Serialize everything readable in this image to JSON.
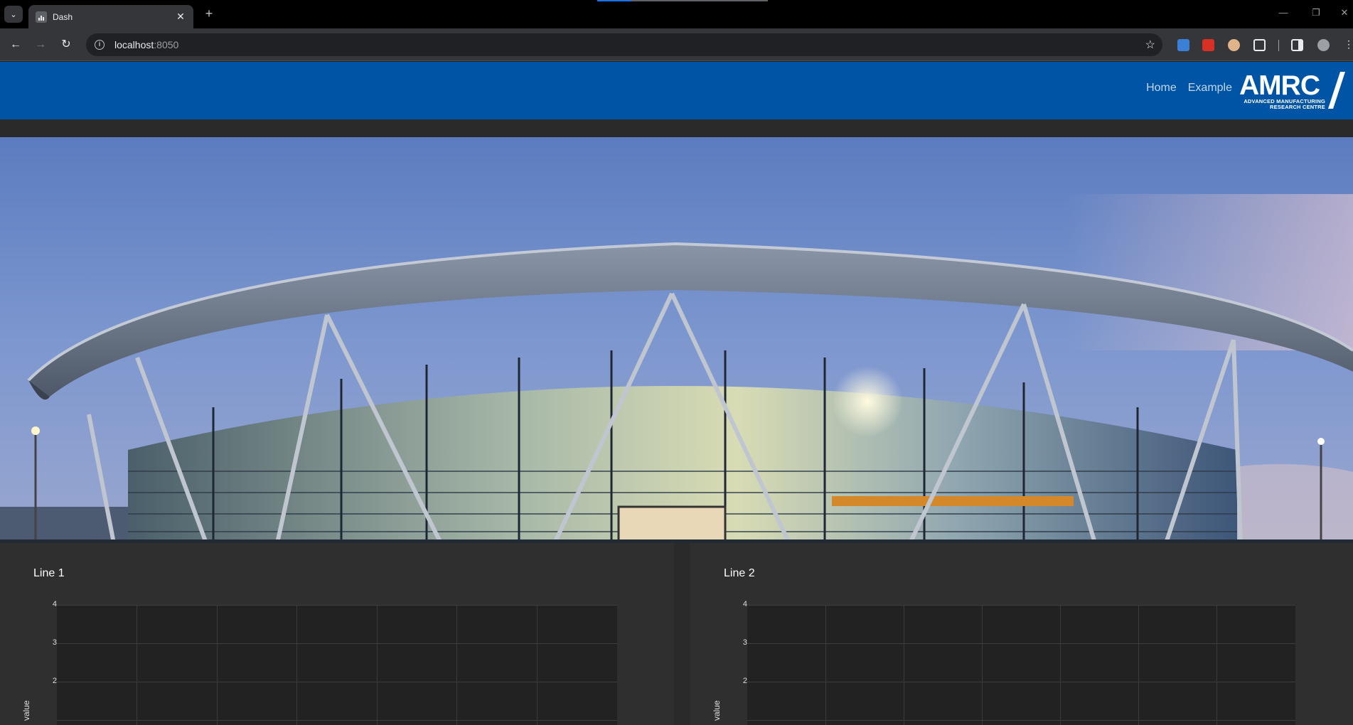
{
  "browser": {
    "tab_title": "Dash",
    "url_host": "localhost",
    "url_port": ":8050"
  },
  "navbar": {
    "links": [
      "Home",
      "Example"
    ],
    "logo": {
      "wordmark": "AMRC",
      "line1": "ADVANCED MANUFACTURING",
      "line2": "RESEARCH CENTRE"
    },
    "color": "#0054a6"
  },
  "cards": [
    {
      "title": "Line 1",
      "ylabel": "value",
      "yticks": [
        "4",
        "3",
        "2"
      ]
    },
    {
      "title": "Line 2",
      "ylabel": "value",
      "yticks": [
        "4",
        "3",
        "2"
      ]
    }
  ],
  "colors": {
    "page_bg": "#2a2a2a",
    "card_bg": "#2f2f2f",
    "plot_bg": "#222222"
  }
}
